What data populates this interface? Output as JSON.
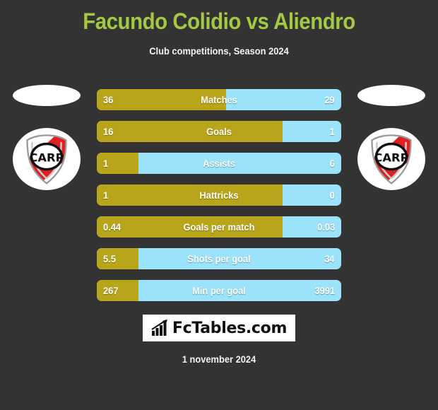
{
  "header": {
    "title": "Facundo Colidio vs Aliendro",
    "subtitle": "Club competitions, Season 2024",
    "title_color": "#a5c844"
  },
  "teams": {
    "home": {
      "crest_name": "river-plate-crest",
      "crest_text": "CARP"
    },
    "away": {
      "crest_name": "river-plate-crest",
      "crest_text": "CARP"
    }
  },
  "brand": {
    "name": "FcTables.com",
    "icon": "bar-chart-growth-icon"
  },
  "footer": {
    "date": "1 november 2024"
  },
  "colors": {
    "background": "#333333",
    "home_bar": "#b8a51a",
    "away_bar": "#9ae3fa",
    "accent": "#a5c844",
    "text": "#ffffff"
  },
  "chart_data": {
    "type": "bar",
    "title": "Facundo Colidio vs Aliendro",
    "subtitle": "Club competitions, Season 2024",
    "orientation": "horizontal-diverging",
    "series": [
      {
        "name": "Facundo Colidio",
        "color": "#b8a51a",
        "side": "left"
      },
      {
        "name": "Aliendro",
        "color": "#9ae3fa",
        "side": "right"
      }
    ],
    "categories": [
      "Matches",
      "Goals",
      "Assists",
      "Hattricks",
      "Goals per match",
      "Shots per goal",
      "Min per goal"
    ],
    "rows": [
      {
        "label": "Matches",
        "home": "36",
        "away": "29",
        "home_pct": 53
      },
      {
        "label": "Goals",
        "home": "16",
        "away": "1",
        "home_pct": 76
      },
      {
        "label": "Assists",
        "home": "1",
        "away": "6",
        "home_pct": 17
      },
      {
        "label": "Hattricks",
        "home": "1",
        "away": "0",
        "home_pct": 76
      },
      {
        "label": "Goals per match",
        "home": "0.44",
        "away": "0.03",
        "home_pct": 76
      },
      {
        "label": "Shots per goal",
        "home": "5.5",
        "away": "34",
        "home_pct": 17
      },
      {
        "label": "Min per goal",
        "home": "267",
        "away": "3991",
        "home_pct": 17
      }
    ],
    "grid": false,
    "legend": "none"
  }
}
